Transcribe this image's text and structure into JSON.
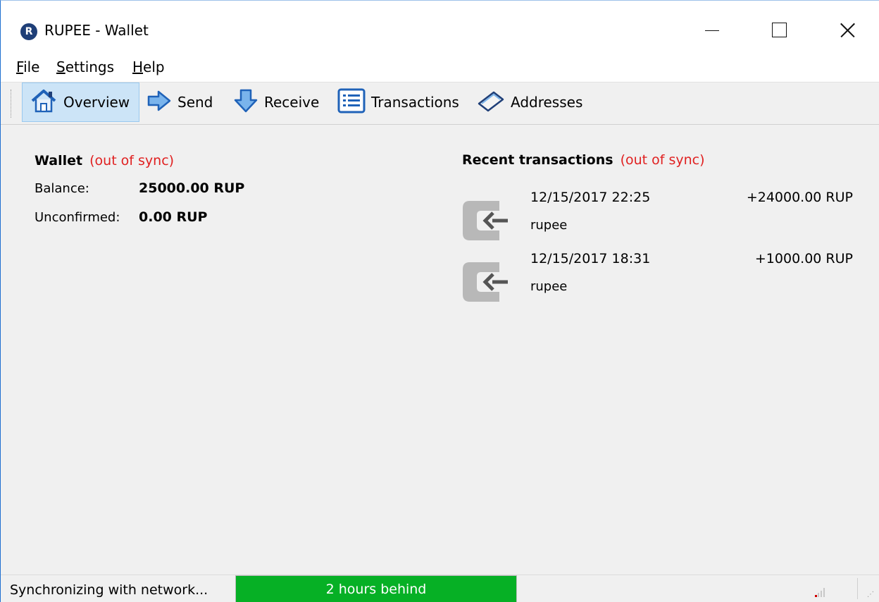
{
  "window": {
    "title": "RUPEE - Wallet",
    "app_icon_letter": "R"
  },
  "menu": {
    "file": "File",
    "settings": "Settings",
    "help": "Help"
  },
  "toolbar": {
    "overview": "Overview",
    "send": "Send",
    "receive": "Receive",
    "transactions": "Transactions",
    "addresses": "Addresses",
    "active": "overview"
  },
  "wallet": {
    "title": "Wallet",
    "sync_status": "(out of sync)",
    "balance_label": "Balance:",
    "balance_value": "25000.00 RUP",
    "unconfirmed_label": "Unconfirmed:",
    "unconfirmed_value": "0.00 RUP"
  },
  "recent": {
    "title": "Recent transactions",
    "sync_status": "(out of sync)",
    "transactions": [
      {
        "date": "12/15/2017 22:25",
        "label": "rupee",
        "amount": "+24000.00 RUP",
        "icon": "received-icon"
      },
      {
        "date": "12/15/2017 18:31",
        "label": "rupee",
        "amount": "+1000.00 RUP",
        "icon": "received-icon"
      }
    ]
  },
  "status": {
    "text": "Synchronizing with network...",
    "progress_text": "2 hours behind",
    "progress_fraction": 1.0,
    "progress_color": "#06b025"
  },
  "colors": {
    "out_of_sync": "#e02020",
    "active_tab_bg": "#cce4f7"
  }
}
